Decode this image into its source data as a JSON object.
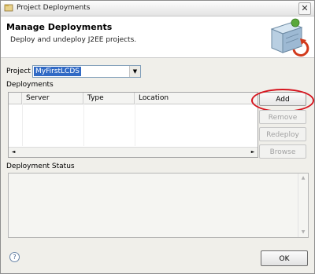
{
  "window": {
    "title": "Project Deployments",
    "close_glyph": "✕"
  },
  "banner": {
    "heading": "Manage Deployments",
    "description": "Deploy and undeploy J2EE projects."
  },
  "project": {
    "label": "Project",
    "selected": "MyFirstLCDS",
    "arrow": "▼"
  },
  "deployments": {
    "label": "Deployments",
    "columns": [
      "Server",
      "Type",
      "Location"
    ],
    "scroll_left": "◄",
    "scroll_right": "►"
  },
  "buttons": {
    "add": "Add",
    "remove": "Remove",
    "redeploy": "Redeploy",
    "browse": "Browse",
    "ok": "OK"
  },
  "status": {
    "label": "Deployment Status",
    "up": "▲",
    "down": "▼"
  },
  "help": {
    "glyph": "?"
  },
  "colors": {
    "highlight": "#d6151f",
    "selection": "#316ac5"
  }
}
